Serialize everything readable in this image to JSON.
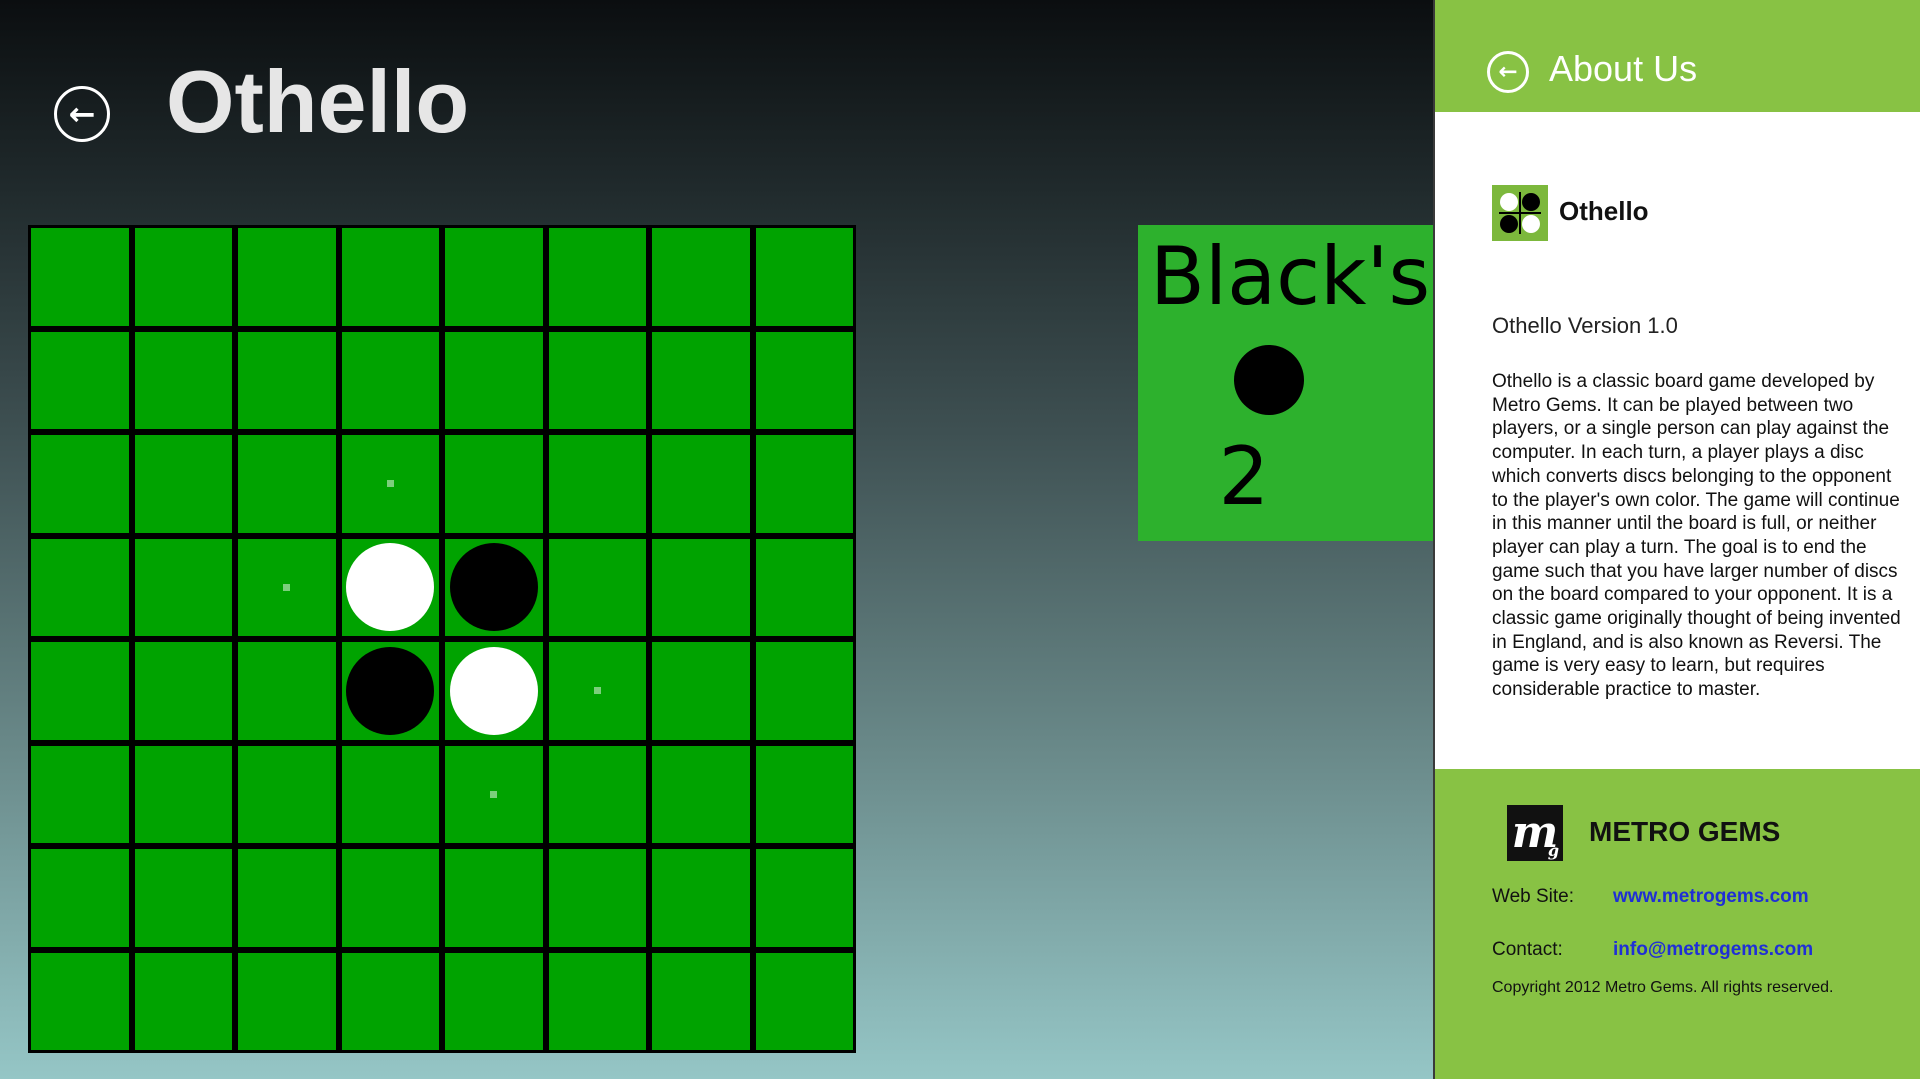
{
  "app": {
    "title": "Othello",
    "back_icon": "arrow-left-circle-icon"
  },
  "board": {
    "size": 8,
    "cells": [
      [
        "",
        "",
        "",
        "",
        "",
        "",
        "",
        ""
      ],
      [
        "",
        "",
        "",
        "",
        "",
        "",
        "",
        ""
      ],
      [
        "",
        "",
        "",
        "hint",
        "",
        "",
        "",
        ""
      ],
      [
        "",
        "",
        "hint",
        "white",
        "black",
        "",
        "",
        ""
      ],
      [
        "",
        "",
        "",
        "black",
        "white",
        "hint",
        "",
        ""
      ],
      [
        "",
        "",
        "",
        "",
        "hint",
        "",
        "",
        ""
      ],
      [
        "",
        "",
        "",
        "",
        "",
        "",
        "",
        ""
      ],
      [
        "",
        "",
        "",
        "",
        "",
        "",
        "",
        ""
      ]
    ],
    "colors": {
      "square": "#00a300",
      "lines": "#000000",
      "hint": "#7ccf7c"
    }
  },
  "turn": {
    "label": "Black's Turn",
    "disc": "black",
    "count": "2",
    "panel_color": "#2db12d"
  },
  "about": {
    "title": "About Us",
    "app_name": "Othello",
    "app_icon": "othello-app-icon",
    "version": "Othello Version 1.0",
    "description": "Othello is a classic board game developed by Metro Gems. It can be played between two players, or a single person can play against the computer. In each turn, a player plays a disc which converts discs belonging to the opponent to the player's own color. The game will continue in this manner until the board is full, or neither player can play a turn. The goal is to end the game such that you have larger number of discs on the board compared to your opponent. It is a classic game originally thought of being invented in England, and is also known as Reversi. The game is very easy to learn, but requires considerable practice to master.",
    "company": "METRO GEMS",
    "logo_text": "m",
    "logo_sub": "g",
    "website_label": "Web Site:",
    "website": "www.metrogems.com",
    "contact_label": "Contact:",
    "contact": "info@metrogems.com",
    "copyright": "Copyright 2012 Metro Gems. All rights reserved.",
    "accent": "#88c244",
    "link_color": "#1f2fd6"
  }
}
